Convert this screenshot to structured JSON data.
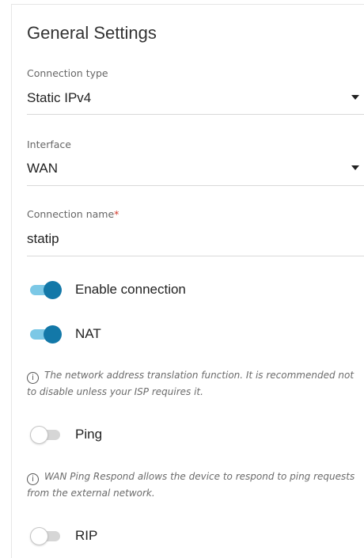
{
  "title": "General Settings",
  "connection_type": {
    "label": "Connection type",
    "value": "Static IPv4"
  },
  "interface": {
    "label": "Interface",
    "value": "WAN"
  },
  "connection_name": {
    "label": "Connection name",
    "required_mark": "*",
    "value": "statip"
  },
  "toggles": [
    {
      "label": "Enable connection",
      "on": true
    },
    {
      "label": "NAT",
      "on": true
    },
    {
      "label": "Ping",
      "on": false
    },
    {
      "label": "RIP",
      "on": false
    }
  ],
  "hints": {
    "nat": "The network address translation function. It is recommended not to disable unless your ISP requires it.",
    "ping": "WAN Ping Respond allows the device to respond to ping requests from the external network."
  },
  "icons": {
    "info": "info-icon",
    "dropdown": "chevron-down-icon"
  },
  "colors": {
    "toggle_on_knob": "#1378a8",
    "toggle_on_track": "#7cc8e6",
    "required": "#d2392b"
  }
}
